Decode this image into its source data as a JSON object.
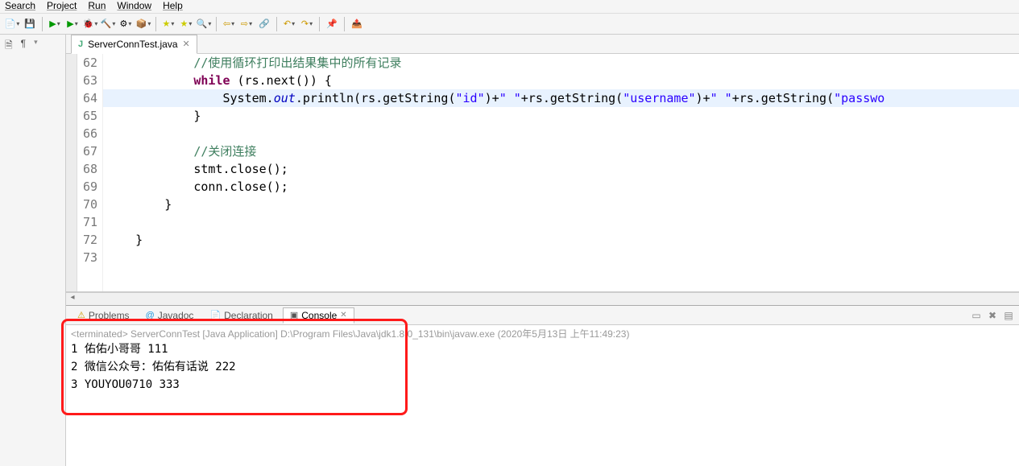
{
  "menubar": {
    "items": [
      "Search",
      "Project",
      "Run",
      "Window",
      "Help"
    ]
  },
  "toolbar": {
    "icons": [
      "📄",
      "💾",
      "▶",
      "▶",
      "🕷",
      "🔨",
      "⚙",
      "📦",
      "🔍",
      "↶",
      "↷",
      "🔗",
      "↩",
      "↪",
      "📂",
      "📤"
    ]
  },
  "left_icons": {
    "a": "🗎",
    "b": "¶"
  },
  "editor": {
    "tab_title": "ServerConnTest.java",
    "tab_close": "✕",
    "lines": [
      {
        "no": "62",
        "html": "            <span class='cm'>//使用循环打印出结果集中的所有记录</span>"
      },
      {
        "no": "63",
        "html": "            <span class='kw'>while</span> (rs.next()) {"
      },
      {
        "no": "64",
        "html": "                System.<span class='fld'>out</span>.println(rs.getString(<span class='str'>\"id\"</span>)+<span class='str'>\" \"</span>+rs.getString(<span class='str'>\"username\"</span>)+<span class='str'>\" \"</span>+rs.getString(<span class='str'>\"passwo</span>",
        "hl": true
      },
      {
        "no": "65",
        "html": "            }"
      },
      {
        "no": "66",
        "html": ""
      },
      {
        "no": "67",
        "html": "            <span class='cm'>//关闭连接</span>"
      },
      {
        "no": "68",
        "html": "            stmt.close();"
      },
      {
        "no": "69",
        "html": "            conn.close();"
      },
      {
        "no": "70",
        "html": "        }"
      },
      {
        "no": "71",
        "html": ""
      },
      {
        "no": "72",
        "html": "    }"
      },
      {
        "no": "73",
        "html": ""
      }
    ]
  },
  "bottom": {
    "tabs": {
      "problems": {
        "label": "Problems",
        "icon": "⚠"
      },
      "javadoc": {
        "label": "Javadoc",
        "icon": "@"
      },
      "declaration": {
        "label": "Declaration",
        "icon": "📄"
      },
      "console": {
        "label": "Console",
        "icon": "▣",
        "close": "✕"
      }
    },
    "toolbar_icons": [
      "▭",
      "✖",
      "▤"
    ],
    "terminated": "<terminated> ServerConnTest [Java Application] D:\\Program Files\\Java\\jdk1.8.0_131\\bin\\javaw.exe (2020年5月13日 上午11:49:23)",
    "output": [
      "1  佑佑小哥哥 111",
      "2  微信公众号：佑佑有话说 222",
      "3  YOUYOU0710  333"
    ]
  }
}
